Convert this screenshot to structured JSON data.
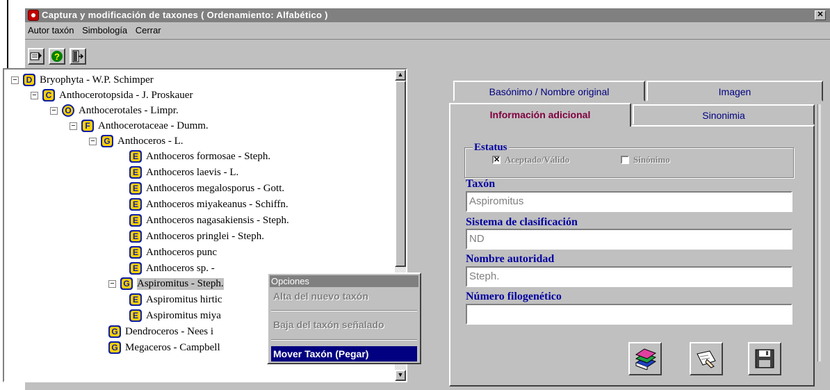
{
  "window": {
    "title": "Captura y modificación de taxones  ( Ordenamiento: Alfabético )",
    "close_glyph": "✕"
  },
  "menubar": [
    "Autor taxón",
    "Simbología",
    "Cerrar"
  ],
  "toolbar": {
    "icons": [
      "taxon-tool-icon",
      "help-icon",
      "exit-icon"
    ]
  },
  "tree": {
    "nodes": [
      {
        "label": "Bryophyta - W.P. Schimper",
        "rank": "D",
        "expander": "−"
      },
      {
        "label": "Anthocerotopsida - J. Proskauer",
        "rank": "C",
        "expander": "−"
      },
      {
        "label": "Anthocerotales - Limpr.",
        "rank": "O",
        "expander": "−"
      },
      {
        "label": "Anthocerotaceae - Dumm.",
        "rank": "F",
        "expander": "−"
      },
      {
        "label": "Anthoceros - L.",
        "rank": "G",
        "expander": "−"
      },
      {
        "label": "Anthoceros formosae - Steph.",
        "rank": "E"
      },
      {
        "label": "Anthoceros laevis - L.",
        "rank": "E"
      },
      {
        "label": "Anthoceros megalosporus - Gott.",
        "rank": "E"
      },
      {
        "label": "Anthoceros miyakeanus - Schiffn.",
        "rank": "E"
      },
      {
        "label": "Anthoceros nagasakiensis - Steph.",
        "rank": "E"
      },
      {
        "label": "Anthoceros pringlei - Steph.",
        "rank": "E"
      },
      {
        "label": "Anthoceros punc",
        "rank": "E"
      },
      {
        "label": "Anthoceros sp. - ",
        "rank": "E"
      },
      {
        "label": "Aspiromitus - Steph.",
        "rank": "G",
        "expander": "−"
      },
      {
        "label": "Aspiromitus hirtic",
        "rank": "E"
      },
      {
        "label": "Aspiromitus miya",
        "rank": "E"
      },
      {
        "label": "Dendroceros - Nees i",
        "rank": "G"
      },
      {
        "label": "Megaceros - Campbell",
        "rank": "G"
      }
    ]
  },
  "context_menu": {
    "header": "Opciones",
    "items": [
      "Alta del nuevo taxón",
      "Baja del taxón señalado",
      "Mover Taxón (Pegar)"
    ]
  },
  "tabs": {
    "top_row": [
      "Basónimo / Nombre original",
      "Imagen"
    ],
    "bottom_row": [
      "Información adicional",
      "Sinonimia"
    ]
  },
  "form": {
    "estatus_legend": "Estatus",
    "aceptado_label": "Aceptado/Válido",
    "aceptado_checked": true,
    "sinonimo_label": "Sinónimo",
    "sinonimo_checked": false,
    "taxon_label": "Taxón",
    "taxon_value": "Aspiromitus",
    "sistema_label": "Sistema de clasificación",
    "sistema_value": "ND",
    "autoridad_label": "Nombre autoridad",
    "autoridad_value": "Steph.",
    "filogenetico_label": "Número filogenético",
    "filogenetico_value": ""
  },
  "actions": {
    "icons": [
      "books-icon",
      "edit-hand-icon",
      "save-disk-icon"
    ]
  },
  "colors": {
    "window_bg": "#c0c0c0",
    "title_bar": "#808080",
    "menu_highlight": "#000080",
    "field_label": "#0000a0",
    "active_tab": "#800040"
  }
}
